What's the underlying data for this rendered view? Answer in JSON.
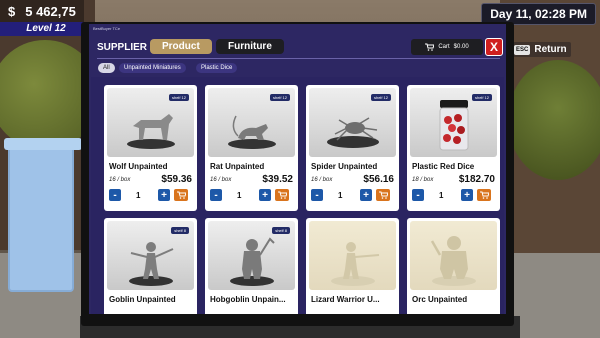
{
  "hud": {
    "money_icon": "$",
    "money": "5 462,75",
    "level": "Level 12",
    "time": "Day 11, 02:28 PM"
  },
  "screen": {
    "title": "BestBuyer TCe",
    "supplier_label": "SUPPLIER",
    "tabs": [
      {
        "label": "Product",
        "active": true
      },
      {
        "label": "Furniture",
        "active": false
      }
    ],
    "cart_label": "Cart",
    "cart_total": "$0.00",
    "close_label": "X",
    "filters": [
      "All",
      "Unpainted Miniatures",
      "Plastic Dice"
    ]
  },
  "return": {
    "key": "ESC",
    "label": "Return"
  },
  "products": [
    {
      "name": "Wolf Unpainted",
      "shelf": "shelf 12",
      "per_box": "16 / box",
      "price": "$59.36",
      "qty": "1",
      "figure": "wolf"
    },
    {
      "name": "Rat Unpainted",
      "shelf": "shelf 12",
      "per_box": "16 / box",
      "price": "$39.52",
      "qty": "1",
      "figure": "rat"
    },
    {
      "name": "Spider Unpainted",
      "shelf": "shelf 12",
      "per_box": "16 / box",
      "price": "$56.16",
      "qty": "1",
      "figure": "spider"
    },
    {
      "name": "Plastic Red Dice",
      "shelf": "shelf 12",
      "per_box": "18 / box",
      "price": "$182.70",
      "qty": "1",
      "figure": "dice"
    },
    {
      "name": "Goblin Unpainted",
      "shelf": "shelf 8",
      "figure": "goblin"
    },
    {
      "name": "Hobgoblin Unpain...",
      "shelf": "shelf 8",
      "figure": "hobgoblin"
    },
    {
      "name": "Lizard Warrior U...",
      "figure": "lizard"
    },
    {
      "name": "Orc Unpainted",
      "figure": "orc"
    }
  ],
  "colors": {
    "screen_bg": "#2d2763",
    "tab_active": "#b89a62",
    "qty_button": "#1d58a8",
    "cart_button": "#d9741d",
    "close_button": "#d01f1f"
  }
}
